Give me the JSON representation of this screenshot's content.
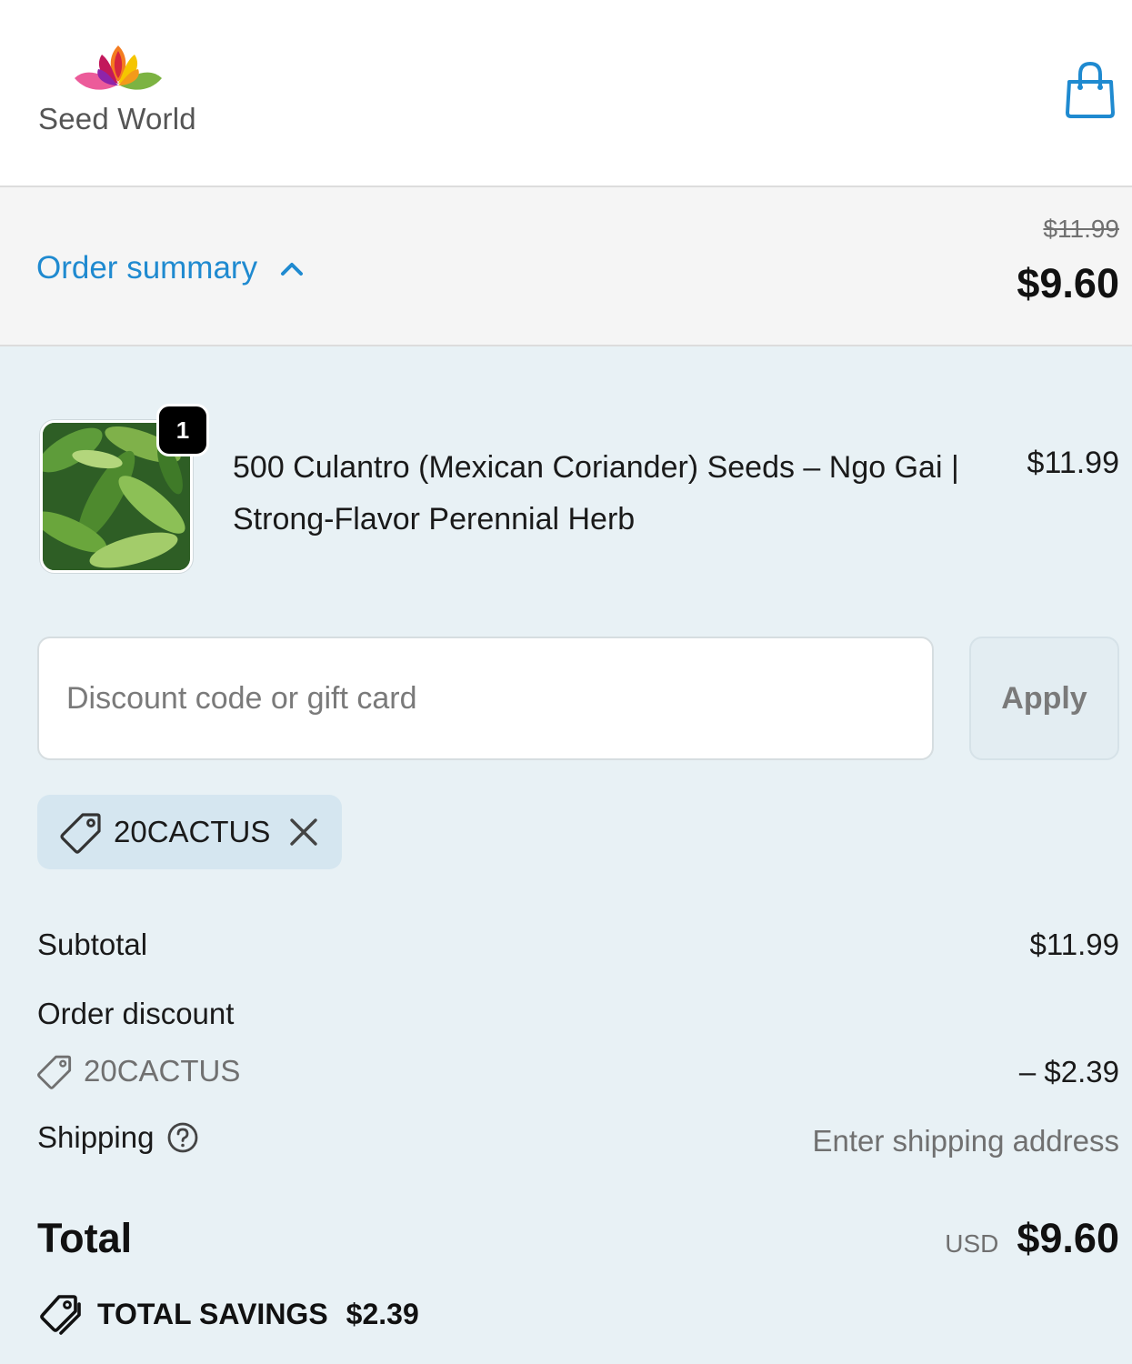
{
  "brand": {
    "name": "Seed World",
    "logo_colors": [
      "#e7337a",
      "#f39a1a",
      "#f5c500",
      "#7cb342",
      "#c62828",
      "#8e24aa"
    ]
  },
  "header": {
    "cart_icon": "shopping-bag-icon"
  },
  "colors": {
    "accent": "#1f8ad0",
    "summary_bg": "#f5f5f5",
    "panel_bg": "#e8f1f5"
  },
  "summary": {
    "toggle_label": "Order summary",
    "toggle_icon": "chevron-up-icon",
    "original_price": "$11.99",
    "price": "$9.60"
  },
  "product": {
    "quantity": "1",
    "title": "500 Culantro (Mexican Coriander) Seeds – Ngo Gai | Strong-Flavor Perennial Herb",
    "price": "$11.99"
  },
  "discount_form": {
    "placeholder": "Discount code or gift card",
    "value": "",
    "apply_label": "Apply"
  },
  "applied_code": {
    "code": "20CACTUS",
    "icon": "tag-icon",
    "remove_icon": "close-icon"
  },
  "costs": {
    "subtotal_label": "Subtotal",
    "subtotal_value": "$11.99",
    "order_discount_label": "Order discount",
    "discount_code": "20CACTUS",
    "discount_value": "– $2.39",
    "shipping_label": "Shipping",
    "shipping_help_icon": "question-circle-icon",
    "shipping_value": "Enter shipping address",
    "total_label": "Total",
    "total_currency": "USD",
    "total_value": "$9.60",
    "savings_label": "TOTAL SAVINGS",
    "savings_value": "$2.39"
  }
}
